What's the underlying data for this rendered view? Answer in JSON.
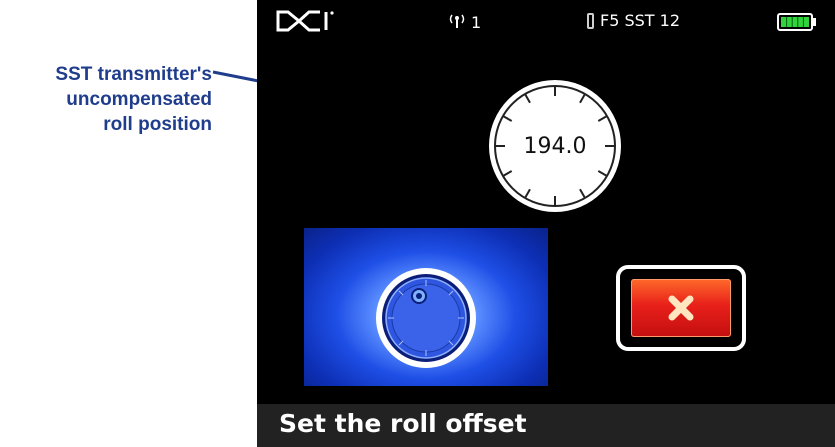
{
  "callout": {
    "line1": "SST transmitter's",
    "line2": "uncompensated",
    "line3": "roll position"
  },
  "statusbar": {
    "logo": "DCI",
    "signal_channel": "1",
    "device_info": "F5 SST 12"
  },
  "dial": {
    "roll_value": "194.0"
  },
  "message": {
    "text": "Set the roll offset"
  },
  "icons": {
    "logo": "dci-logo",
    "signal": "antenna-signal-icon",
    "transmitter": "transmitter-icon",
    "battery": "battery-full-icon",
    "confirm": "roll-dial-confirm-icon",
    "cancel": "close-x-icon"
  },
  "colors": {
    "callout": "#1f3d8c",
    "battery": "#2fd33b",
    "confirm_bg": "#1e4fe6",
    "cancel_bg": "#e8201a",
    "cancel_x": "#ffd9a0"
  }
}
